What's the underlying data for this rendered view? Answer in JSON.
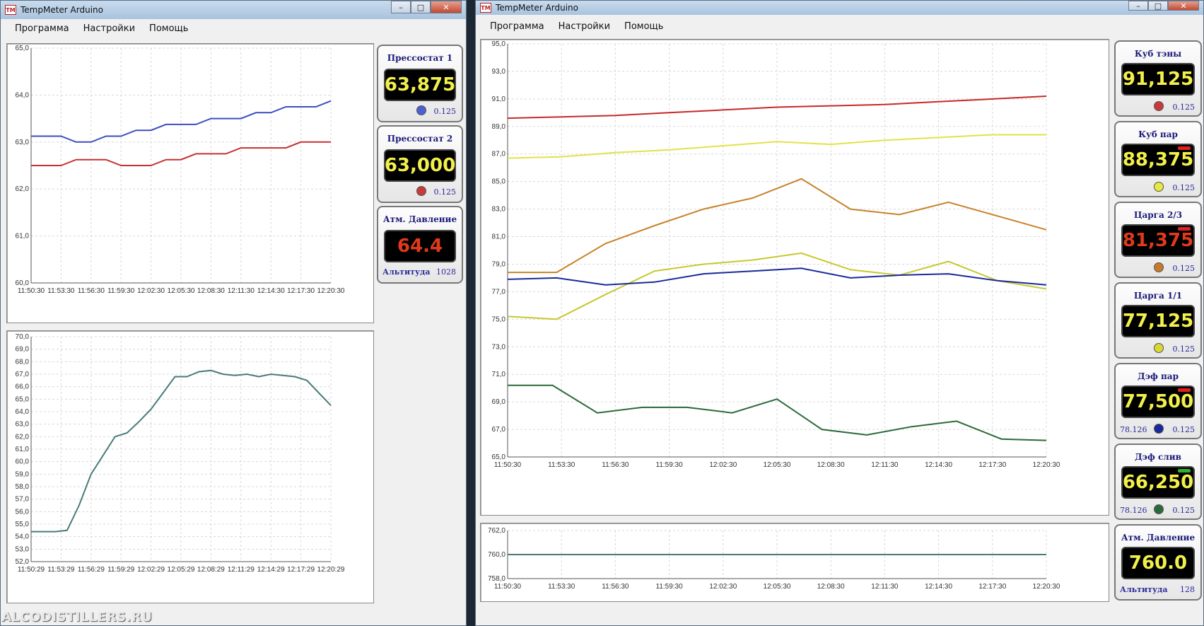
{
  "left_window": {
    "title": "TempMeter Arduino",
    "menu": [
      "Программа",
      "Настройки",
      "Помощь"
    ],
    "cards": [
      {
        "label": "Прессостат 1",
        "value": "63,875",
        "step": "0.125",
        "dot_color": "#4a5fd1"
      },
      {
        "label": "Прессостат 2",
        "value": "63,000",
        "step": "0.125",
        "dot_color": "#c83a3a"
      },
      {
        "label": "Атм. Давление",
        "value": "64.4",
        "sub_label": "Альтитуда",
        "sub_value": "1028"
      }
    ]
  },
  "right_window": {
    "title": "TempMeter Arduino",
    "menu": [
      "Программа",
      "Настройки",
      "Помощь"
    ],
    "cards": [
      {
        "label": "Куб тэны",
        "value": "91,125",
        "step": "0.125",
        "dot_color": "#c83a3a",
        "indicator": "#e02020"
      },
      {
        "label": "Куб пар",
        "value": "88,375",
        "step": "0.125",
        "dot_color": "#e8e840",
        "indicator": "#e02020"
      },
      {
        "label": "Царга 2/3",
        "value": "81,375",
        "step": "0.125",
        "dot_color": "#c87a2a",
        "indicator": "#e02020"
      },
      {
        "label": "Царга 1/1",
        "value": "77,125",
        "step": "0.125",
        "dot_color": "#d8d830"
      },
      {
        "label": "Дэф пар",
        "value": "77,500",
        "step": "0.125",
        "left_value": "78.126",
        "dot_color": "#1a2a9a",
        "indicator": "#e02020"
      },
      {
        "label": "Дэф слив",
        "value": "66,250",
        "step": "0.125",
        "left_value": "78.126",
        "dot_color": "#2a6a3a",
        "indicator": "#30b030"
      },
      {
        "label": "Атм. Давление",
        "value": "760.0",
        "sub_label": "Альтитуда",
        "sub_value": "128"
      }
    ]
  },
  "watermark": "ALCODISTILLERS.RU",
  "chart_data": [
    {
      "type": "line",
      "ylim": [
        60.0,
        65.0
      ],
      "y_ticks": [
        "60,0",
        "61,0",
        "62,0",
        "63,0",
        "64,0",
        "65,0"
      ],
      "x_ticks": [
        "11:50:30",
        "11:53:30",
        "11:56:30",
        "11:59:30",
        "12:02:30",
        "12:05:30",
        "12:08:30",
        "12:11:30",
        "12:14:30",
        "12:17:30",
        "12:20:30"
      ],
      "series": [
        {
          "color": "#3a4fbf",
          "values": [
            63.125,
            63.125,
            63.125,
            63.0,
            63.0,
            63.125,
            63.125,
            63.25,
            63.25,
            63.375,
            63.375,
            63.375,
            63.5,
            63.5,
            63.5,
            63.625,
            63.625,
            63.75,
            63.75,
            63.75,
            63.875
          ]
        },
        {
          "color": "#c83030",
          "values": [
            62.5,
            62.5,
            62.5,
            62.625,
            62.625,
            62.625,
            62.5,
            62.5,
            62.5,
            62.625,
            62.625,
            62.75,
            62.75,
            62.75,
            62.875,
            62.875,
            62.875,
            62.875,
            63.0,
            63.0,
            63.0
          ]
        }
      ]
    },
    {
      "type": "line",
      "ylim": [
        52.0,
        70.0
      ],
      "y_ticks": [
        "52,0",
        "53,0",
        "54,0",
        "55,0",
        "56,0",
        "57,0",
        "58,0",
        "59,0",
        "60,0",
        "61,0",
        "62,0",
        "63,0",
        "64,0",
        "65,0",
        "66,0",
        "67,0",
        "68,0",
        "69,0",
        "70,0"
      ],
      "x_ticks": [
        "11:50:29",
        "11:53:29",
        "11:56:29",
        "11:59:29",
        "12:02:29",
        "12:05:29",
        "12:08:29",
        "12:11:29",
        "12:14:29",
        "12:17:29",
        "12:20:29"
      ],
      "series": [
        {
          "color": "#4a7a7a",
          "values": [
            54.4,
            54.4,
            54.4,
            54.5,
            56.5,
            59.0,
            60.5,
            62.0,
            62.3,
            63.2,
            64.2,
            65.5,
            66.8,
            66.8,
            67.2,
            67.3,
            67.0,
            66.9,
            67.0,
            66.8,
            67.0,
            66.9,
            66.8,
            66.5,
            65.5,
            64.5
          ]
        }
      ]
    },
    {
      "type": "line",
      "ylim": [
        65.0,
        95.0
      ],
      "y_ticks": [
        "65,0",
        "67,0",
        "69,0",
        "71,0",
        "73,0",
        "75,0",
        "77,0",
        "79,0",
        "81,0",
        "83,0",
        "85,0",
        "87,0",
        "89,0",
        "91,0",
        "93,0",
        "95,0"
      ],
      "x_ticks": [
        "11:50:30",
        "11:53:30",
        "11:56:30",
        "11:59:30",
        "12:02:30",
        "12:05:30",
        "12:08:30",
        "12:11:30",
        "12:14:30",
        "12:17:30",
        "12:20:30"
      ],
      "series": [
        {
          "color": "#c82828",
          "values": [
            89.6,
            89.7,
            89.8,
            90.0,
            90.2,
            90.4,
            90.5,
            90.6,
            90.8,
            91.0,
            91.2
          ]
        },
        {
          "color": "#e2e248",
          "values": [
            86.7,
            86.8,
            87.1,
            87.3,
            87.6,
            87.9,
            87.7,
            88.0,
            88.2,
            88.4,
            88.4
          ]
        },
        {
          "color": "#c8822a",
          "values": [
            78.4,
            78.4,
            80.5,
            81.8,
            83.0,
            83.8,
            85.2,
            83.0,
            82.6,
            83.5,
            82.5,
            81.5
          ]
        },
        {
          "color": "#c8c830",
          "values": [
            75.2,
            75.0,
            76.8,
            78.5,
            79.0,
            79.3,
            79.8,
            78.6,
            78.2,
            79.2,
            77.8,
            77.2
          ]
        },
        {
          "color": "#1a2a9a",
          "values": [
            77.9,
            78.0,
            77.5,
            77.7,
            78.3,
            78.5,
            78.7,
            78.0,
            78.2,
            78.3,
            77.8,
            77.5
          ]
        },
        {
          "color": "#2a6a3a",
          "values": [
            70.2,
            70.2,
            68.2,
            68.6,
            68.6,
            68.2,
            69.2,
            67.0,
            66.6,
            67.2,
            67.6,
            66.3,
            66.2
          ]
        }
      ]
    },
    {
      "type": "line",
      "ylim": [
        758.0,
        762.0
      ],
      "y_ticks": [
        "758,0",
        "760,0",
        "762,0"
      ],
      "x_ticks": [
        "11:50:30",
        "11:53:30",
        "11:56:30",
        "11:59:30",
        "12:02:30",
        "12:05:30",
        "12:08:30",
        "12:11:30",
        "12:14:30",
        "12:17:30",
        "12:20:30"
      ],
      "series": [
        {
          "color": "#4a7a7a",
          "values": [
            760.0,
            760.0,
            760.0,
            760.0,
            760.0,
            760.0,
            760.0,
            760.0,
            760.0,
            760.0,
            760.0
          ]
        }
      ]
    }
  ]
}
